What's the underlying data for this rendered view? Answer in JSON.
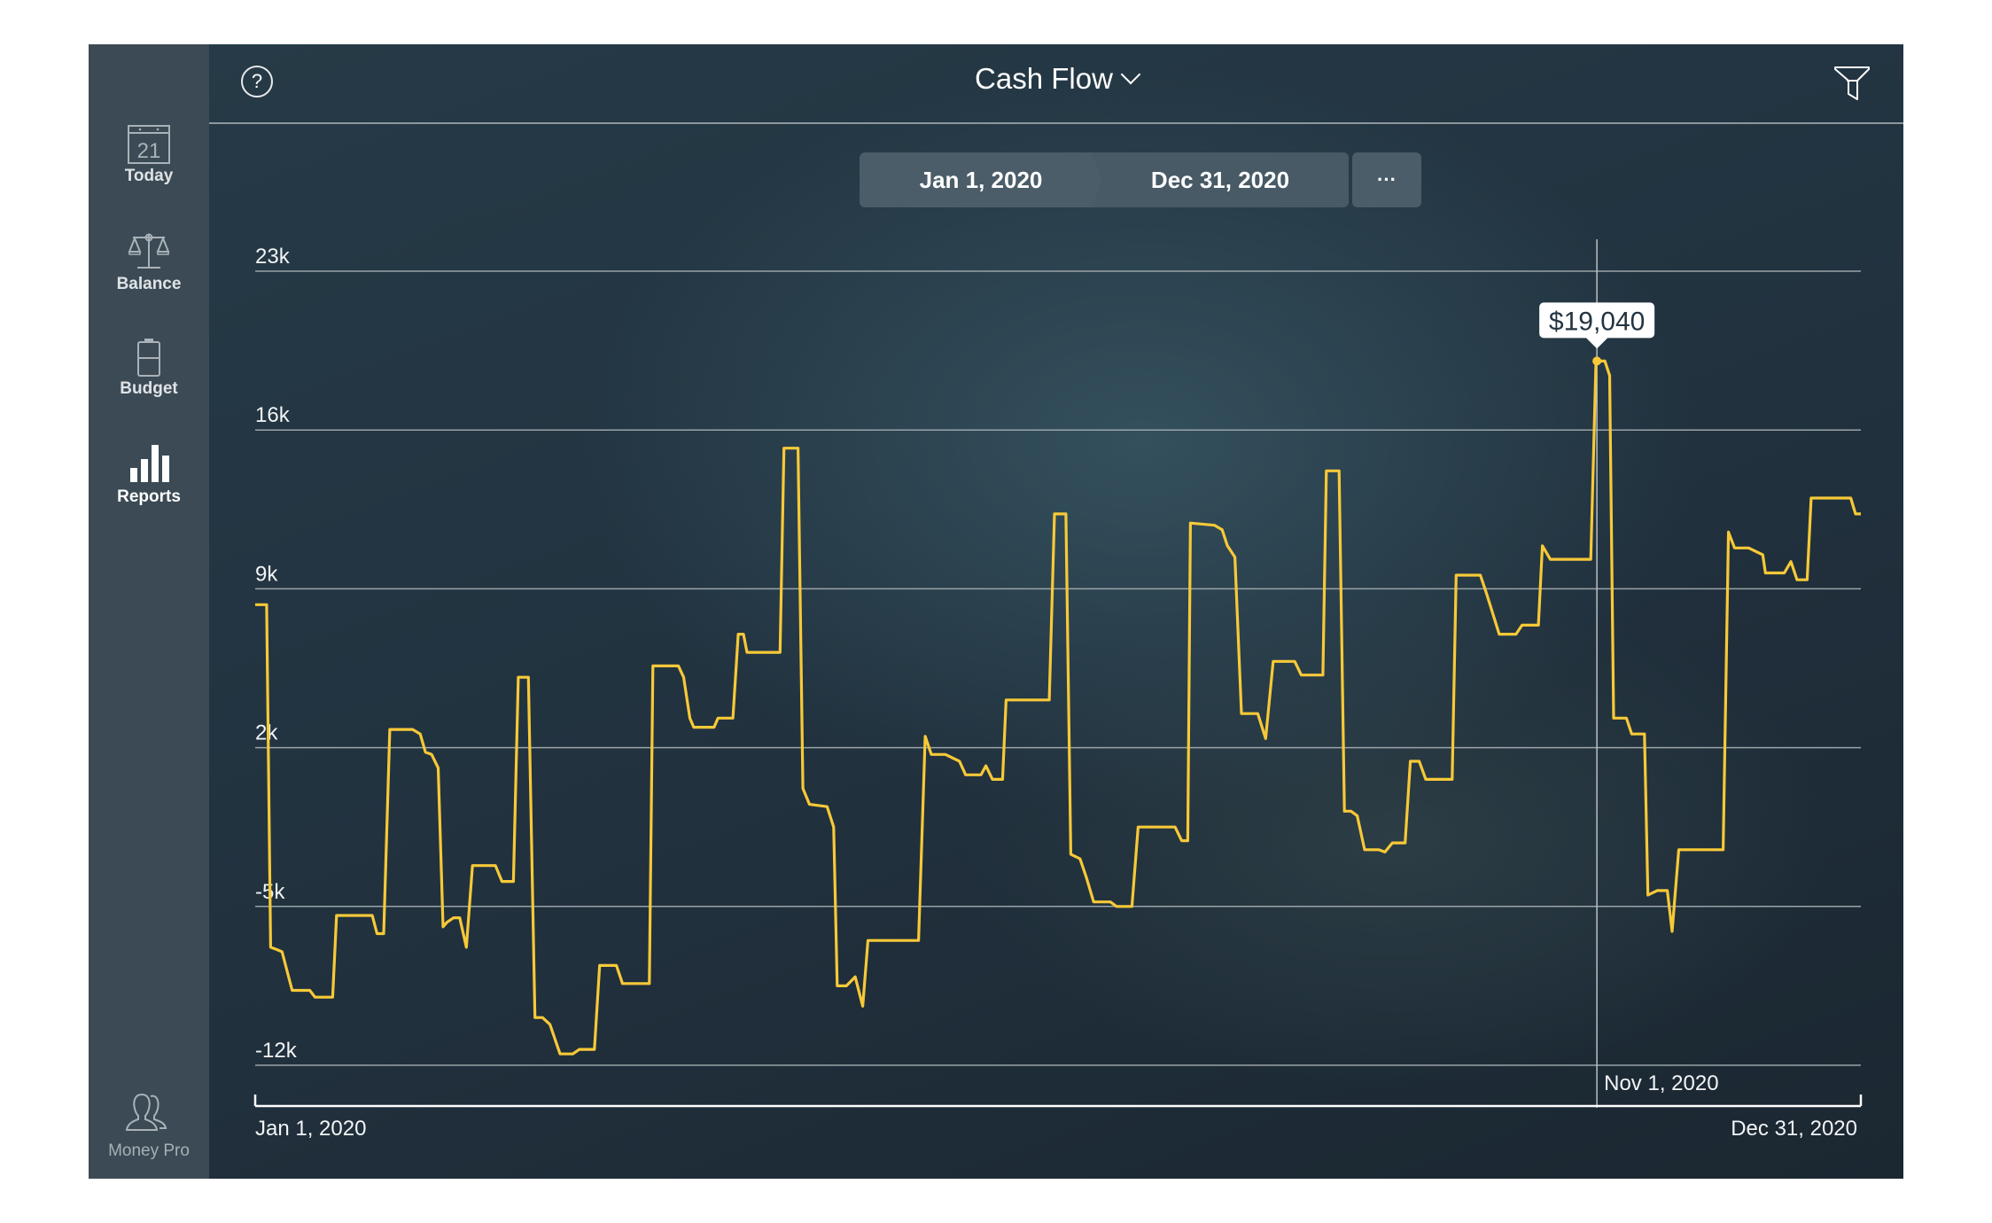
{
  "sidebar": {
    "items": [
      {
        "label": "Today",
        "icon": "calendar-icon",
        "icon_text": "21",
        "active": false
      },
      {
        "label": "Balance",
        "icon": "scales-icon",
        "active": false
      },
      {
        "label": "Budget",
        "icon": "battery-icon",
        "active": false
      },
      {
        "label": "Reports",
        "icon": "bar-chart-icon",
        "active": true
      }
    ],
    "footer": {
      "label": "Money Pro",
      "icon": "users-icon"
    }
  },
  "header": {
    "help_icon_text": "?",
    "title": "Cash Flow",
    "filter_icon": "filter-icon"
  },
  "date_range": {
    "start": "Jan 1, 2020",
    "end": "Dec 31, 2020",
    "more_label": "···"
  },
  "colors": {
    "line": "#f7c938",
    "grid": "#9aa3a8",
    "sidebar_bg": "#3b4a54",
    "main_bg": "#223340"
  },
  "chart_data": {
    "type": "line",
    "title": "Cash Flow",
    "xlabel": "",
    "ylabel": "",
    "x_unit": "day_of_year_2020",
    "x_range": [
      0,
      365
    ],
    "x_tick_labels": [
      "Jan 1, 2020",
      "Dec 31, 2020"
    ],
    "ylim": [
      -12000,
      23000
    ],
    "y_ticks": [
      23000,
      16000,
      9000,
      2000,
      -5000,
      -12000
    ],
    "y_tick_labels": [
      "23k",
      "16k",
      "9k",
      "2k",
      "-5k",
      "-12k"
    ],
    "grid": true,
    "cursor": {
      "day": 305,
      "date_label": "Nov 1, 2020",
      "value": 19040,
      "value_label": "$19,040"
    },
    "series": [
      {
        "name": "Cash Flow",
        "points": [
          [
            0,
            8300
          ],
          [
            2.6,
            8300
          ],
          [
            3.5,
            -6800
          ],
          [
            4.9,
            -6900
          ],
          [
            6.1,
            -7000
          ],
          [
            8.4,
            -8700
          ],
          [
            12.4,
            -8700
          ],
          [
            13.6,
            -9000
          ],
          [
            17.6,
            -9000
          ],
          [
            18.5,
            -5400
          ],
          [
            26.6,
            -5400
          ],
          [
            27.7,
            -6200
          ],
          [
            29.2,
            -6200
          ],
          [
            30.6,
            2800
          ],
          [
            35.8,
            2800
          ],
          [
            37.5,
            2600
          ],
          [
            38.7,
            1800
          ],
          [
            40.1,
            1700
          ],
          [
            41.6,
            1100
          ],
          [
            42.7,
            -5900
          ],
          [
            43.6,
            -5700
          ],
          [
            45.1,
            -5500
          ],
          [
            46.5,
            -5500
          ],
          [
            48,
            -6800
          ],
          [
            49.4,
            -3200
          ],
          [
            54.6,
            -3200
          ],
          [
            56.1,
            -3900
          ],
          [
            58.7,
            -3900
          ],
          [
            59.8,
            5100
          ],
          [
            62.1,
            5100
          ],
          [
            63.6,
            -9900
          ],
          [
            65.3,
            -9900
          ],
          [
            67,
            -10200
          ],
          [
            69.3,
            -11500
          ],
          [
            72.2,
            -11500
          ],
          [
            73.7,
            -11300
          ],
          [
            77.1,
            -11300
          ],
          [
            78.3,
            -7600
          ],
          [
            82.1,
            -7600
          ],
          [
            83.5,
            -8400
          ],
          [
            89.6,
            -8400
          ],
          [
            90.4,
            5600
          ],
          [
            96.2,
            5600
          ],
          [
            97.4,
            5100
          ],
          [
            98.8,
            3300
          ],
          [
            99.7,
            2900
          ],
          [
            104.3,
            2900
          ],
          [
            105.2,
            3300
          ],
          [
            108.6,
            3300
          ],
          [
            109.8,
            7000
          ],
          [
            111,
            7000
          ],
          [
            111.8,
            6200
          ],
          [
            119.3,
            6200
          ],
          [
            120.2,
            15200
          ],
          [
            123.4,
            15200
          ],
          [
            124.5,
            200
          ],
          [
            126,
            -500
          ],
          [
            130,
            -600
          ],
          [
            131.5,
            -1500
          ],
          [
            132.3,
            -8500
          ],
          [
            134.4,
            -8500
          ],
          [
            136.4,
            -8100
          ],
          [
            138.1,
            -9400
          ],
          [
            139.3,
            -6500
          ],
          [
            150.8,
            -6500
          ],
          [
            152.3,
            2500
          ],
          [
            153.7,
            1700
          ],
          [
            156.9,
            1700
          ],
          [
            160.1,
            1400
          ],
          [
            161.5,
            800
          ],
          [
            165,
            800
          ],
          [
            166.1,
            1200
          ],
          [
            167.6,
            600
          ],
          [
            169.9,
            600
          ],
          [
            170.7,
            4100
          ],
          [
            180.5,
            4100
          ],
          [
            181.7,
            12300
          ],
          [
            184.3,
            12300
          ],
          [
            185.4,
            -2700
          ],
          [
            187.5,
            -2900
          ],
          [
            188.9,
            -3700
          ],
          [
            190.6,
            -4800
          ],
          [
            194.4,
            -4800
          ],
          [
            195.8,
            -5000
          ],
          [
            199.3,
            -5000
          ],
          [
            200.7,
            -1500
          ],
          [
            209.1,
            -1500
          ],
          [
            210.6,
            -2100
          ],
          [
            212,
            -2100
          ],
          [
            212.6,
            11900
          ],
          [
            218.1,
            11800
          ],
          [
            219.8,
            11600
          ],
          [
            221,
            10900
          ],
          [
            222.7,
            10400
          ],
          [
            224.2,
            3500
          ],
          [
            225.6,
            3500
          ],
          [
            227.9,
            3500
          ],
          [
            229.7,
            2400
          ],
          [
            231.4,
            5800
          ],
          [
            236.3,
            5800
          ],
          [
            237.8,
            5200
          ],
          [
            242.7,
            5200
          ],
          [
            243.5,
            14200
          ],
          [
            246.4,
            14200
          ],
          [
            247.6,
            -800
          ],
          [
            249.1,
            -800
          ],
          [
            250.5,
            -1000
          ],
          [
            252.2,
            -2500
          ],
          [
            255.4,
            -2500
          ],
          [
            256.8,
            -2600
          ],
          [
            258.5,
            -2200
          ],
          [
            261.4,
            -2200
          ],
          [
            262.6,
            1400
          ],
          [
            264.6,
            1400
          ],
          [
            266.1,
            600
          ],
          [
            272.1,
            600
          ],
          [
            273,
            9600
          ],
          [
            278.5,
            9600
          ],
          [
            279.9,
            8800
          ],
          [
            282.8,
            7000
          ],
          [
            286.6,
            7000
          ],
          [
            288,
            7400
          ],
          [
            291.7,
            7400
          ],
          [
            292.6,
            10900
          ],
          [
            294.4,
            10300
          ],
          [
            296.7,
            10300
          ],
          [
            303.6,
            10300
          ],
          [
            304.8,
            19040
          ],
          [
            306.8,
            19040
          ],
          [
            307.9,
            18400
          ],
          [
            308.8,
            3300
          ],
          [
            311.7,
            3300
          ],
          [
            312.9,
            2600
          ],
          [
            315.8,
            2600
          ],
          [
            316.6,
            -4500
          ],
          [
            318.7,
            -4300
          ],
          [
            321,
            -4300
          ],
          [
            322.1,
            -6100
          ],
          [
            323.6,
            -2500
          ],
          [
            333.7,
            -2500
          ],
          [
            334.9,
            11500
          ],
          [
            336.3,
            10800
          ],
          [
            339.5,
            10800
          ],
          [
            342.7,
            10500
          ],
          [
            343.3,
            9700
          ],
          [
            347.6,
            9700
          ],
          [
            349.1,
            10200
          ],
          [
            350.5,
            9400
          ],
          [
            352.8,
            9400
          ],
          [
            353.7,
            13000
          ],
          [
            362.7,
            13000
          ],
          [
            363.8,
            12300
          ],
          [
            365,
            12300
          ]
        ]
      }
    ]
  }
}
